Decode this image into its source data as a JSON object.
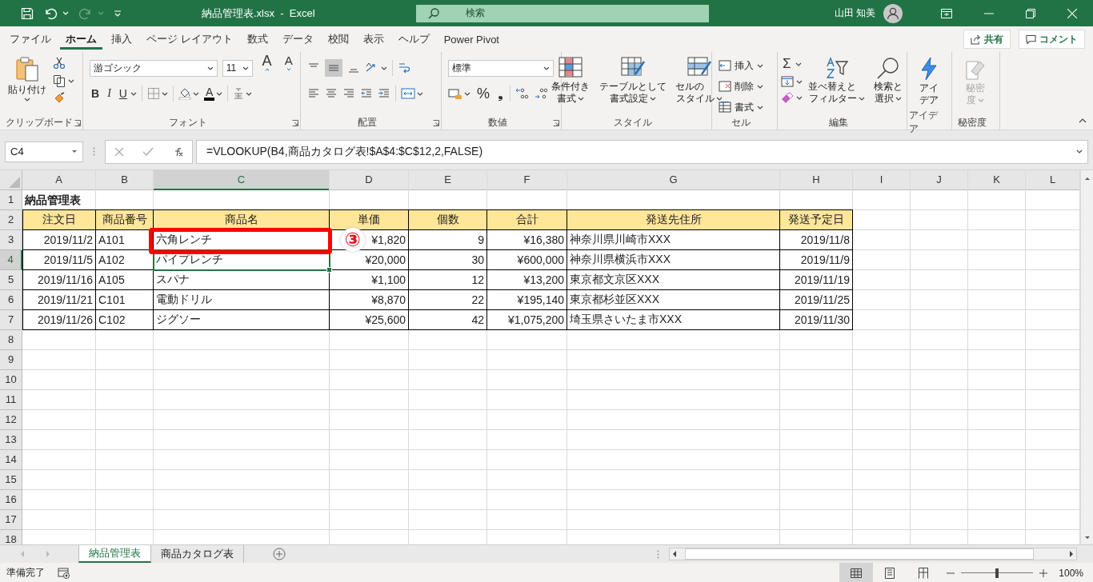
{
  "title_bar": {
    "title": "納品管理表.xlsx  -  Excel",
    "search_placeholder": "検索",
    "user": "山田 知美"
  },
  "menu_tabs": [
    {
      "label": "ファイル",
      "selected": false
    },
    {
      "label": "ホーム",
      "selected": true
    },
    {
      "label": "挿入",
      "selected": false
    },
    {
      "label": "ページ レイアウト",
      "selected": false
    },
    {
      "label": "数式",
      "selected": false
    },
    {
      "label": "データ",
      "selected": false
    },
    {
      "label": "校閲",
      "selected": false
    },
    {
      "label": "表示",
      "selected": false
    },
    {
      "label": "ヘルプ",
      "selected": false
    },
    {
      "label": "Power Pivot",
      "selected": false
    }
  ],
  "share_button": "共有",
  "comment_button": "コメント",
  "ribbon": {
    "clipboard": {
      "paste": "貼り付け",
      "label": "クリップボード"
    },
    "font": {
      "font_name": "游ゴシック",
      "font_size": "11",
      "grow": "A",
      "shrink": "A",
      "bold": "B",
      "italic": "I",
      "underline": "U",
      "font_color": "A",
      "label": "フォント"
    },
    "alignment": {
      "label": "配置",
      "middle_align": {
        "selected": true
      }
    },
    "number": {
      "format": "標準",
      "percent": "%",
      "comma": "❟",
      "label": "数値"
    },
    "styles": {
      "buttons": [
        "条件付き書式",
        "テーブルとして書式設定",
        "セルのスタイル"
      ],
      "label": "スタイル"
    },
    "cells": {
      "buttons": [
        "挿入",
        "削除",
        "書式"
      ],
      "label": "セル"
    },
    "editing": {
      "autosum": "Σ",
      "buttons": [
        "並べ替えとフィルター",
        "検索と選択"
      ],
      "label": "編集"
    },
    "ideas": {
      "button": "アイデア",
      "label": "アイデア"
    },
    "sensitivity": {
      "button": "秘密度",
      "label": "秘密度",
      "disabled": true
    }
  },
  "formula_bar": {
    "name_box": "C4",
    "formula": "=VLOOKUP(B4,商品カタログ表!$A$4:$C$12,2,FALSE)"
  },
  "columns": [
    {
      "label": "A",
      "selected": false,
      "annotated": false
    },
    {
      "label": "B",
      "selected": false,
      "annotated": false
    },
    {
      "label": "C",
      "selected": true,
      "annotated": true
    },
    {
      "label": "D",
      "selected": false,
      "annotated": false
    },
    {
      "label": "E",
      "selected": false,
      "annotated": false
    },
    {
      "label": "F",
      "selected": false,
      "annotated": false
    },
    {
      "label": "G",
      "selected": false,
      "annotated": false
    },
    {
      "label": "H",
      "selected": false,
      "annotated": false
    },
    {
      "label": "I",
      "selected": false,
      "annotated": false
    },
    {
      "label": "J",
      "selected": false,
      "annotated": false
    },
    {
      "label": "K",
      "selected": false,
      "annotated": false
    },
    {
      "label": "L",
      "selected": false,
      "annotated": false
    }
  ],
  "rows": [
    {
      "header": "1",
      "kind": "title",
      "selected": false,
      "annotated": false,
      "cells": [
        "納品管理表"
      ]
    },
    {
      "header": "2",
      "kind": "header",
      "selected": false,
      "annotated": false,
      "cells": [
        "注文日",
        "商品番号",
        "商品名",
        "単価",
        "個数",
        "合計",
        "発送先住所",
        "発送予定日"
      ]
    },
    {
      "header": "3",
      "kind": "data",
      "selected": false,
      "annotated": true,
      "cells": [
        "2019/11/2",
        "A101",
        "六角レンチ",
        "¥1,820",
        "9",
        "¥16,380",
        "神奈川県川崎市XXX",
        "2019/11/8"
      ]
    },
    {
      "header": "4",
      "kind": "data",
      "selected": true,
      "annotated": false,
      "cells": [
        "2019/11/5",
        "A102",
        "パイプレンチ",
        "¥20,000",
        "30",
        "¥600,000",
        "神奈川県横浜市XXX",
        "2019/11/9"
      ]
    },
    {
      "header": "5",
      "kind": "data",
      "selected": false,
      "annotated": false,
      "cells": [
        "2019/11/16",
        "A105",
        "スパナ",
        "¥1,100",
        "12",
        "¥13,200",
        "東京都文京区XXX",
        "2019/11/19"
      ]
    },
    {
      "header": "6",
      "kind": "data",
      "selected": false,
      "annotated": false,
      "cells": [
        "2019/11/21",
        "C101",
        "電動ドリル",
        "¥8,870",
        "22",
        "¥195,140",
        "東京都杉並区XXX",
        "2019/11/25"
      ]
    },
    {
      "header": "7",
      "kind": "data",
      "selected": false,
      "annotated": false,
      "cells": [
        "2019/11/26",
        "C102",
        "ジグソー",
        "¥25,600",
        "42",
        "¥1,075,200",
        "埼玉県さいたま市XXX",
        "2019/11/30"
      ]
    },
    {
      "header": "8",
      "kind": "empty",
      "selected": false,
      "annotated": false
    },
    {
      "header": "9",
      "kind": "empty",
      "selected": false,
      "annotated": false
    },
    {
      "header": "10",
      "kind": "empty",
      "selected": false,
      "annotated": false
    },
    {
      "header": "11",
      "kind": "empty",
      "selected": false,
      "annotated": false
    },
    {
      "header": "12",
      "kind": "empty",
      "selected": false,
      "annotated": false
    },
    {
      "header": "13",
      "kind": "empty",
      "selected": false,
      "annotated": false
    },
    {
      "header": "14",
      "kind": "empty",
      "selected": false,
      "annotated": false
    },
    {
      "header": "15",
      "kind": "empty",
      "selected": false,
      "annotated": false
    },
    {
      "header": "16",
      "kind": "empty",
      "selected": false,
      "annotated": false
    },
    {
      "header": "17",
      "kind": "empty",
      "selected": false,
      "annotated": false
    },
    {
      "header": "18",
      "kind": "empty",
      "selected": false,
      "annotated": false
    }
  ],
  "annotation": {
    "marker": "③"
  },
  "sheet_tabs": [
    {
      "label": "納品管理表",
      "selected": true
    },
    {
      "label": "商品カタログ表",
      "selected": false
    }
  ],
  "status_bar": {
    "status": "準備完了",
    "views": [
      {
        "kind": "normal",
        "selected": true
      },
      {
        "kind": "page_layout",
        "selected": false
      },
      {
        "kind": "page_break",
        "selected": false
      }
    ],
    "zoom": {
      "level": 0.5,
      "reading": "100%"
    }
  }
}
